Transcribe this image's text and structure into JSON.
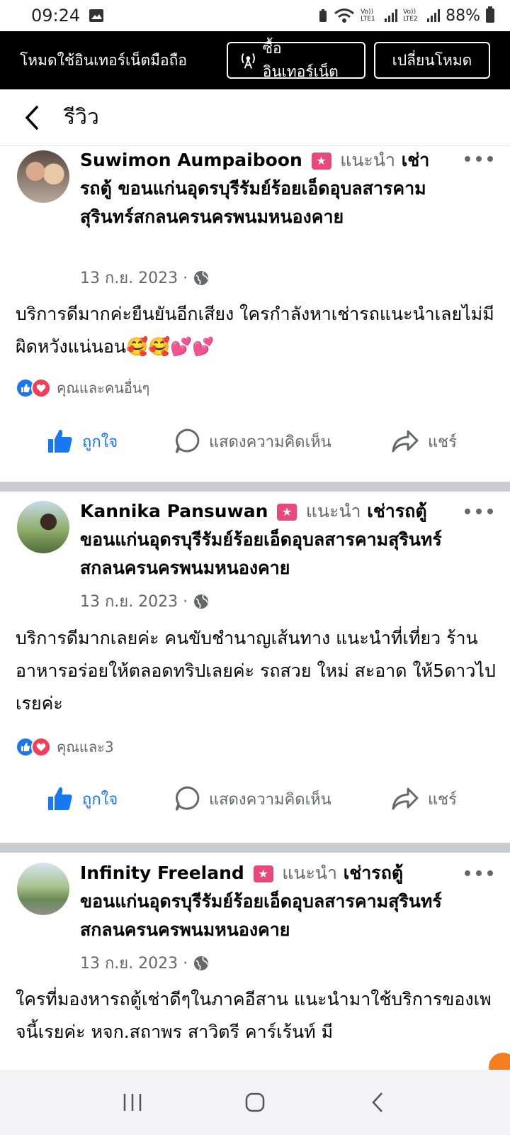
{
  "status": {
    "time": "09:24",
    "battery": "88%",
    "sim1": "Vo)) LTE1",
    "sim2": "Vo)) LTE2"
  },
  "modebar": {
    "text": "โหมดใช้อินเทอร์เน็ตมือถือ",
    "buy_label": "ซื้ออินเทอร์เน็ต",
    "switch_label": "เปลี่ยนโหมด"
  },
  "header": {
    "title": "รีวิว"
  },
  "posts": [
    {
      "name": "Suwimon Aumpaiboon",
      "recommend": "แนะนำ",
      "page": "เช่ารถตู้ ขอนแก่นอุดรบุรีรัมย์ร้อยเอ็ดอุบลสารคามสุรินทร์สกลนครนครพนมหนองคาย",
      "date": "13 ก.ย. 2023 ·",
      "text": "บริการดีมากค่ะยืนยันอีกเสียง ใครกำลังหาเช่ารถแนะนำเลยไม่มีผิดหวังแน่นอน🥰🥰💕💕",
      "reactions": "คุณและคนอื่นๆ"
    },
    {
      "name": "Kannika Pansuwan",
      "recommend": "แนะนำ",
      "page": "เช่ารถตู้ ขอนแก่นอุดรบุรีรัมย์ร้อยเอ็ดอุบลสารคามสุรินทร์สกลนครนครพนมหนองคาย",
      "date": "13 ก.ย. 2023 ·",
      "text": "บริการดีมากเลยค่ะ คนขับชำนาญเส้นทาง แนะนำที่เที่ยว ร้านอาหารอร่อยให้ตลอดทริปเลยค่ะ รถสวย ใหม่ สะอาด ให้5ดาวไปเรยค่ะ",
      "reactions": "คุณและ3"
    },
    {
      "name": "Infinity Freeland",
      "recommend": "แนะนำ",
      "page": "เช่ารถตู้ ขอนแก่นอุดรบุรีรัมย์ร้อยเอ็ดอุบลสารคามสุรินทร์สกลนครนครพนมหนองคาย",
      "date": "13 ก.ย. 2023 ·",
      "text": "ใครที่มองหารถตู้เช่าดีๆในภาคอีสาน แนะนำมาใช้บริการของเพจนี้เรยค่ะ หจก.สถาพร สาวิตรี คาร์เร้นท์ มี"
    }
  ],
  "actions": {
    "like": "ถูกใจ",
    "comment": "แสดงความคิดเห็น",
    "share": "แชร์"
  },
  "colors": {
    "accent": "#1877f2",
    "love": "#f33e58",
    "badge": "#e8487a",
    "divider": "#c9ccd1"
  }
}
